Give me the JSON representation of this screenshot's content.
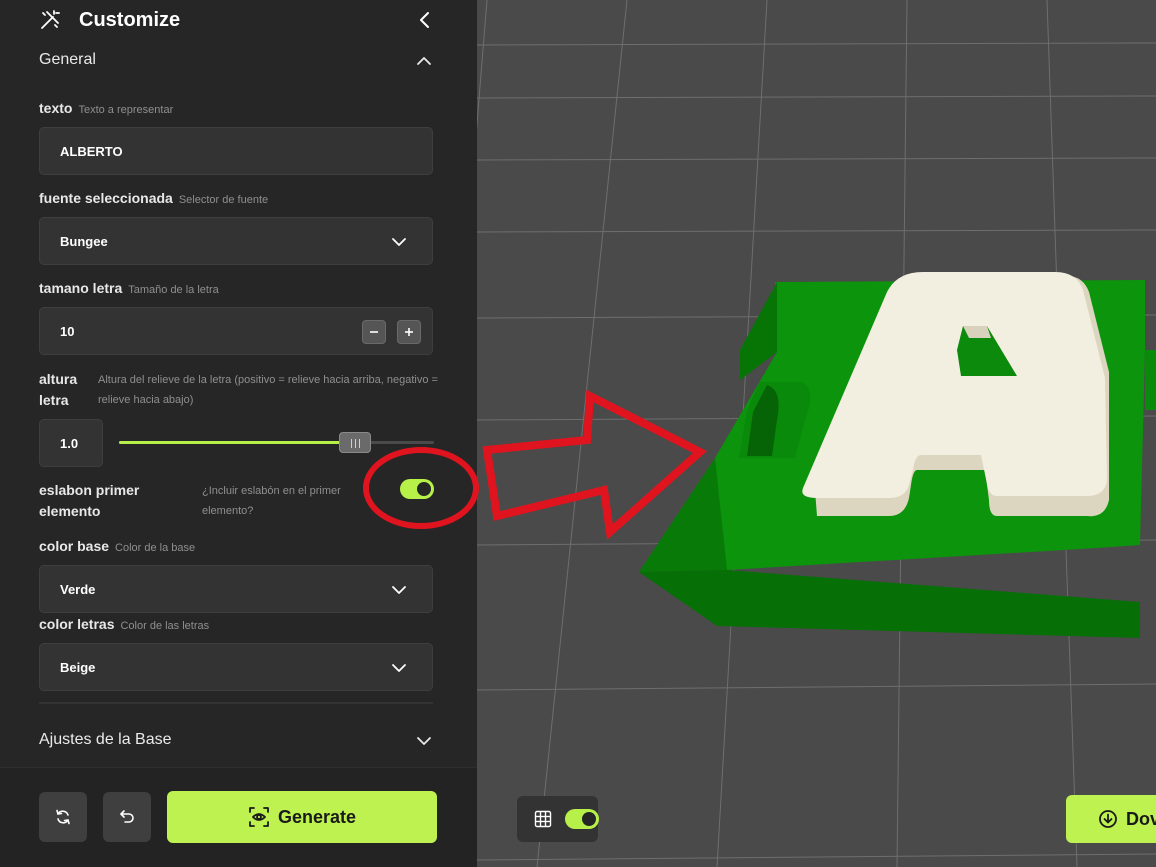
{
  "sidebar": {
    "title": "Customize",
    "sections": {
      "general": "General",
      "base_settings": "Ajustes de la Base"
    },
    "fields": {
      "texto": {
        "label": "texto",
        "hint": "Texto a representar",
        "value": "ALBERTO"
      },
      "fuente": {
        "label": "fuente seleccionada",
        "hint": "Selector de fuente",
        "value": "Bungee"
      },
      "tamano": {
        "label": "tamano letra",
        "hint": "Tamaño de la letra",
        "value": "10"
      },
      "altura": {
        "label": "altura letra",
        "hint": "Altura del relieve de la letra (positivo = relieve hacia arriba, negativo = relieve hacia abajo)",
        "value": "1.0",
        "slider_fraction": 0.75
      },
      "eslabon": {
        "label": "eslabon primer elemento",
        "hint": "¿Incluir eslabón en el primer elemento?",
        "enabled": true
      },
      "color_base": {
        "label": "color base",
        "hint": "Color de la base",
        "value": "Verde"
      },
      "color_letras": {
        "label": "color letras",
        "hint": "Color de las letras",
        "value": "Beige"
      }
    }
  },
  "footer": {
    "generate_label": "Generate"
  },
  "viewport": {
    "grid_toggle_on": true,
    "download_label": "Dov",
    "model_letter": "A"
  },
  "colors": {
    "accent": "#bdf250",
    "sidebar_bg": "#262626",
    "field_bg": "#333333",
    "viewport_bg": "#4a4a4a",
    "model_base": "#0b8a0b",
    "model_letters": "#f3efe0",
    "annotation": "#e0141e"
  },
  "icons": {
    "logo": "wand-ruler-icon",
    "collapse": "chevron-left-icon",
    "reset": "refresh-icon",
    "undo": "undo-icon",
    "generate": "eye-scan-icon",
    "grid": "grid-icon",
    "download": "download-circle-icon"
  }
}
